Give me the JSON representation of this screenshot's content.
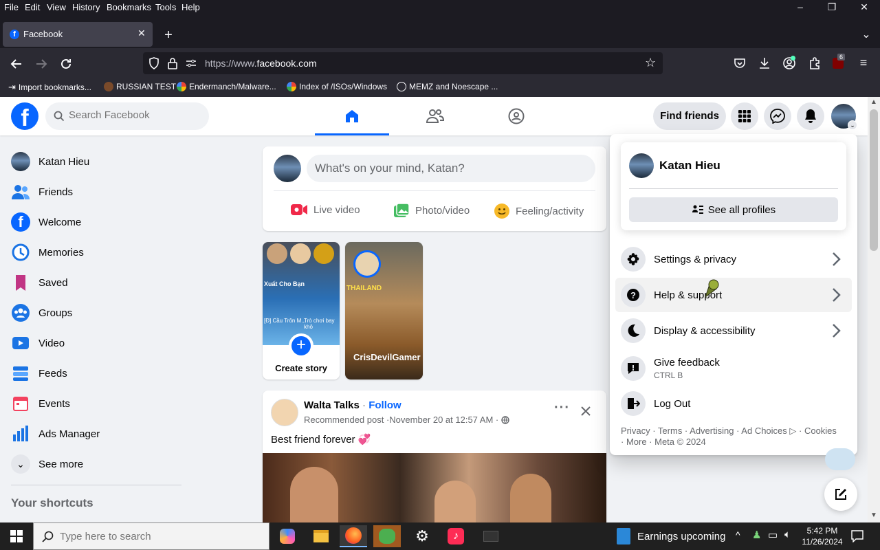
{
  "menubar": {
    "items": [
      "File",
      "Edit",
      "View",
      "History",
      "Bookmarks",
      "Tools",
      "Help"
    ]
  },
  "tab": {
    "title": "Facebook"
  },
  "urlbar": {
    "url_prefix": "https://www.",
    "url_domain": "facebook.com"
  },
  "extensions": {
    "badge_count": "6"
  },
  "bookmarks": [
    {
      "label": "Import bookmarks...",
      "icon": "import-icon"
    },
    {
      "label": "RUSSIAN TEST",
      "icon": "site-icon"
    },
    {
      "label": "Endermanch/Malware...",
      "icon": "google-icon"
    },
    {
      "label": "Index of /ISOs/Windows",
      "icon": "google-icon"
    },
    {
      "label": "MEMZ and Noescape ...",
      "icon": "globe-icon"
    }
  ],
  "header": {
    "search_placeholder": "Search Facebook",
    "find_friends": "Find friends"
  },
  "sidebar": {
    "items": [
      {
        "label": "Katan Hieu",
        "icon": "avatar"
      },
      {
        "label": "Friends",
        "icon": "friends-icon"
      },
      {
        "label": "Welcome",
        "icon": "facebook-icon"
      },
      {
        "label": "Memories",
        "icon": "clock-icon"
      },
      {
        "label": "Saved",
        "icon": "bookmark-icon"
      },
      {
        "label": "Groups",
        "icon": "groups-icon"
      },
      {
        "label": "Video",
        "icon": "video-icon"
      },
      {
        "label": "Feeds",
        "icon": "feeds-icon"
      },
      {
        "label": "Events",
        "icon": "calendar-icon"
      },
      {
        "label": "Ads Manager",
        "icon": "bar-chart-icon"
      },
      {
        "label": "See more",
        "icon": "chevron-down-icon"
      }
    ],
    "shortcuts_title": "Your shortcuts"
  },
  "composer": {
    "placeholder": "What's on your mind, Katan?",
    "actions": [
      "Live video",
      "Photo/video",
      "Feeling/activity"
    ]
  },
  "stories": {
    "create_label": "Create story",
    "story1_text1": "Xuất Cho Bạn",
    "story1_text2": "[Đ] Cầu Trôn M...",
    "story1_text3": "Trò chơi bay khô",
    "story2_author": "CrisDevilGamer",
    "story2_sign": "THAILAND"
  },
  "post": {
    "author": "Walta Talks",
    "sep": " · ",
    "follow": "Follow",
    "meta_prefix": "Recommended post · ",
    "meta_date": "November 20 at 12:57 AM",
    "meta_suffix": " · ",
    "text": "Best friend forever 💞"
  },
  "dropdown": {
    "profile_name": "Katan Hieu",
    "see_all_profiles": "See all profiles",
    "items": [
      {
        "label": "Settings & privacy",
        "icon": "gear-icon",
        "sub": ""
      },
      {
        "label": "Help & support",
        "icon": "help-icon",
        "sub": ""
      },
      {
        "label": "Display & accessibility",
        "icon": "moon-icon",
        "sub": ""
      },
      {
        "label": "Give feedback",
        "icon": "feedback-icon",
        "sub": "CTRL B"
      },
      {
        "label": "Log Out",
        "icon": "logout-icon",
        "sub": ""
      }
    ],
    "footer_line1": "Privacy · Terms · Advertising · Ad Choices ▷ · Cookies",
    "footer_line2": "· More · Meta © 2024"
  },
  "taskbar": {
    "search_placeholder": "Type here to search",
    "news": "Earnings upcoming",
    "time": "5:42 PM",
    "date": "11/26/2024"
  },
  "colors": {
    "fb_blue": "#0866ff",
    "chrome_dark": "#1c1b22",
    "toolbar": "#2b2a33"
  }
}
